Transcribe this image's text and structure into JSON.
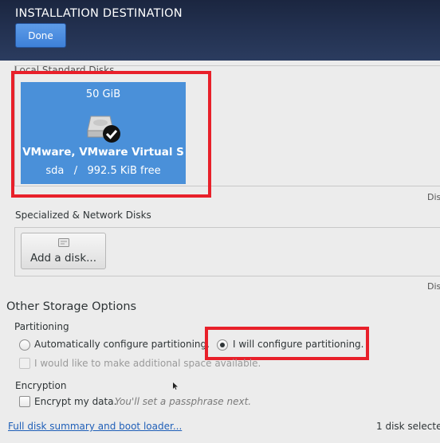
{
  "header": {
    "title": "INSTALLATION DESTINATION",
    "done_label": "Done"
  },
  "local_disks": {
    "label": "Local Standard Disks",
    "disk": {
      "size": "50 GiB",
      "name": "VMware, VMware Virtual S",
      "free": "sda   /   992.5 KiB free",
      "selected": true,
      "icon": "hard-disk-icon"
    },
    "edge_text": "Dis"
  },
  "network_disks": {
    "label": "Specialized & Network Disks",
    "add_label": "Add a disk...",
    "edge_text": "Dis"
  },
  "other_storage": {
    "title": "Other Storage Options",
    "partitioning": {
      "label": "Partitioning",
      "auto_label": "Automatically configure partitioning.",
      "manual_label": "I will configure partitioning.",
      "selected": "manual",
      "extra_space_label": "I would like to make additional space available."
    },
    "encryption": {
      "label": "Encryption",
      "encrypt_label": "Encrypt my data.",
      "encrypt_hint": "You'll set a passphrase next."
    }
  },
  "footer": {
    "summary_link": "Full disk summary and boot loader...",
    "status": "1 disk selecte"
  },
  "colors": {
    "header": "#22304f",
    "accent": "#4a90d9",
    "highlight": "#e8202a"
  }
}
